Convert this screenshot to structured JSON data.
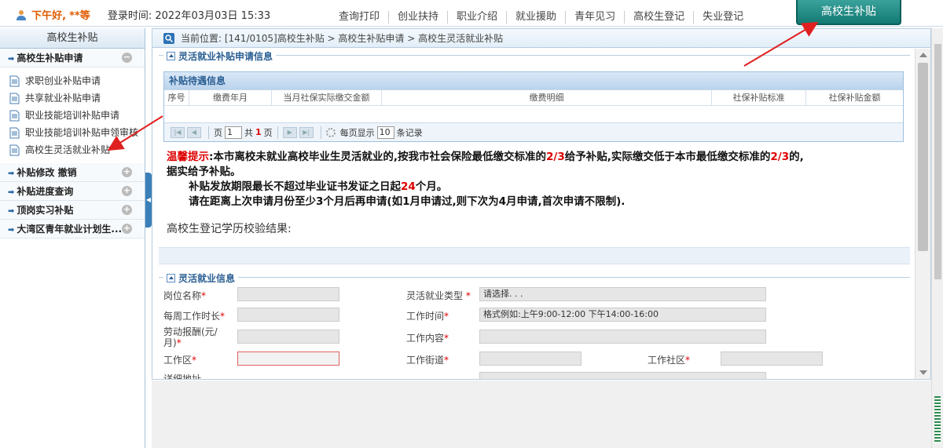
{
  "header": {
    "greeting_prefix": "下午好,",
    "username": "**等",
    "login_label": "登录时间:",
    "login_time": "2022年03月03日 15:33",
    "nav": [
      "查询打印",
      "创业扶持",
      "职业介绍",
      "就业援助",
      "青年见习",
      "高校生登记",
      "失业登记"
    ],
    "highlight_tab": "高校生补贴"
  },
  "sidebar": {
    "title": "高校生补贴",
    "groups": [
      {
        "label": "高校生补贴申请",
        "toggle": "−",
        "items": [
          "求职创业补贴申请",
          "共享就业补贴申请",
          "职业技能培训补贴申请",
          "职业技能培训补贴申领审核",
          "高校生灵活就业补贴"
        ]
      },
      {
        "label": "补贴修改 撤销",
        "toggle": "+"
      },
      {
        "label": "补贴进度查询",
        "toggle": "+"
      },
      {
        "label": "顶岗实习补贴",
        "toggle": "+"
      },
      {
        "label": "大湾区青年就业计划生...",
        "toggle": "+"
      }
    ]
  },
  "breadcrumb": "当前位置:  [141/0105]高校生补贴 > 高校生补贴申请 > 高校生灵活就业补贴",
  "section1": {
    "legend": "灵活就业补贴申请信息",
    "table_title": "补贴待遇信息",
    "columns": [
      "序号",
      "缴费年月",
      "当月社保实际缴交金额",
      "缴费明细",
      "社保补贴标准",
      "社保补贴金额"
    ],
    "pager": {
      "page_label": "页",
      "page_value": "1",
      "total_prefix": "共",
      "total_pages": "1",
      "total_suffix": "页",
      "per_page_label": "每页显示",
      "per_page_value": "10",
      "records_label": "条记录"
    }
  },
  "tips": {
    "label": "温馨提示",
    "line1_a": ":本市离校未就业高校毕业生灵活就业的,按我市社会保险最低缴交标准的",
    "ratio": "2/3",
    "line1_b": "给予补贴,实际缴交低于本市最低缴交标准的",
    "line1_c": "的,",
    "line2": "据实给予补贴。",
    "line3_a": "补贴发放期限最长不超过毕业证书发证之日起",
    "months": "24",
    "line3_b": "个月。",
    "line4": "请在距离上次申请月份至少3个月后再申请(如1月申请过,则下次为4月申请,首次申请不限制)."
  },
  "verify_label": "高校生登记学历校验结果:",
  "section2": {
    "legend": "灵活就业信息",
    "fields": {
      "position": "岗位名称",
      "type": "灵活就业类型",
      "type_value": "请选择. . .",
      "weekly_hours": "每周工作时长",
      "work_time": "工作时间",
      "work_time_value": "格式例如:上午9:00-12:00 下午14:00-16:00",
      "pay": "劳动报酬(元/月)",
      "content": "工作内容",
      "district": "工作区",
      "street": "工作街道",
      "community": "工作社区",
      "cut": "详细地址"
    }
  },
  "colors": {
    "accent": "#2b5f93",
    "tab": "#137a73",
    "alert": "#dd0000"
  }
}
